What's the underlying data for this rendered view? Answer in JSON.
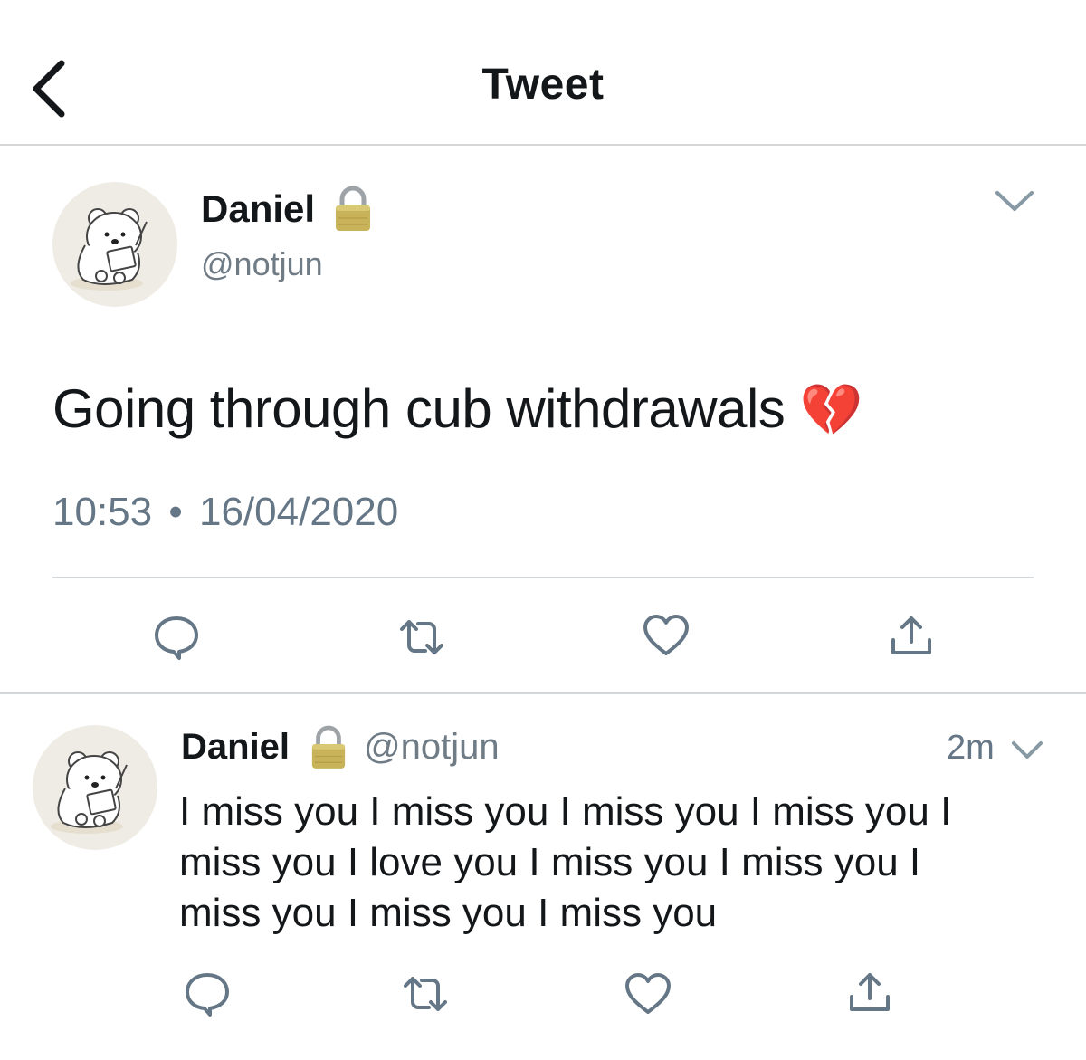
{
  "header": {
    "title": "Tweet"
  },
  "main_tweet": {
    "name": "Daniel",
    "handle": "@notjun",
    "text": "Going through cub withdrawals",
    "emoji": "💔",
    "time": "10:53",
    "separator": "•",
    "date": "16/04/2020"
  },
  "reply": {
    "name": "Daniel",
    "handle": "@notjun",
    "age": "2m",
    "text": "I miss you I miss you I miss you I miss you I miss you I love you I miss you I miss you I miss you I miss you I miss you"
  },
  "icons": {
    "back": "chevron-left-icon",
    "lock": "lock-icon",
    "menu": "chevron-down-icon",
    "reply": "reply-icon",
    "retweet": "retweet-icon",
    "like": "heart-icon",
    "share": "share-icon"
  },
  "colors": {
    "text": "#14171a",
    "muted": "#657786",
    "divider": "#d4d7da",
    "lock": "#c9b35a"
  }
}
